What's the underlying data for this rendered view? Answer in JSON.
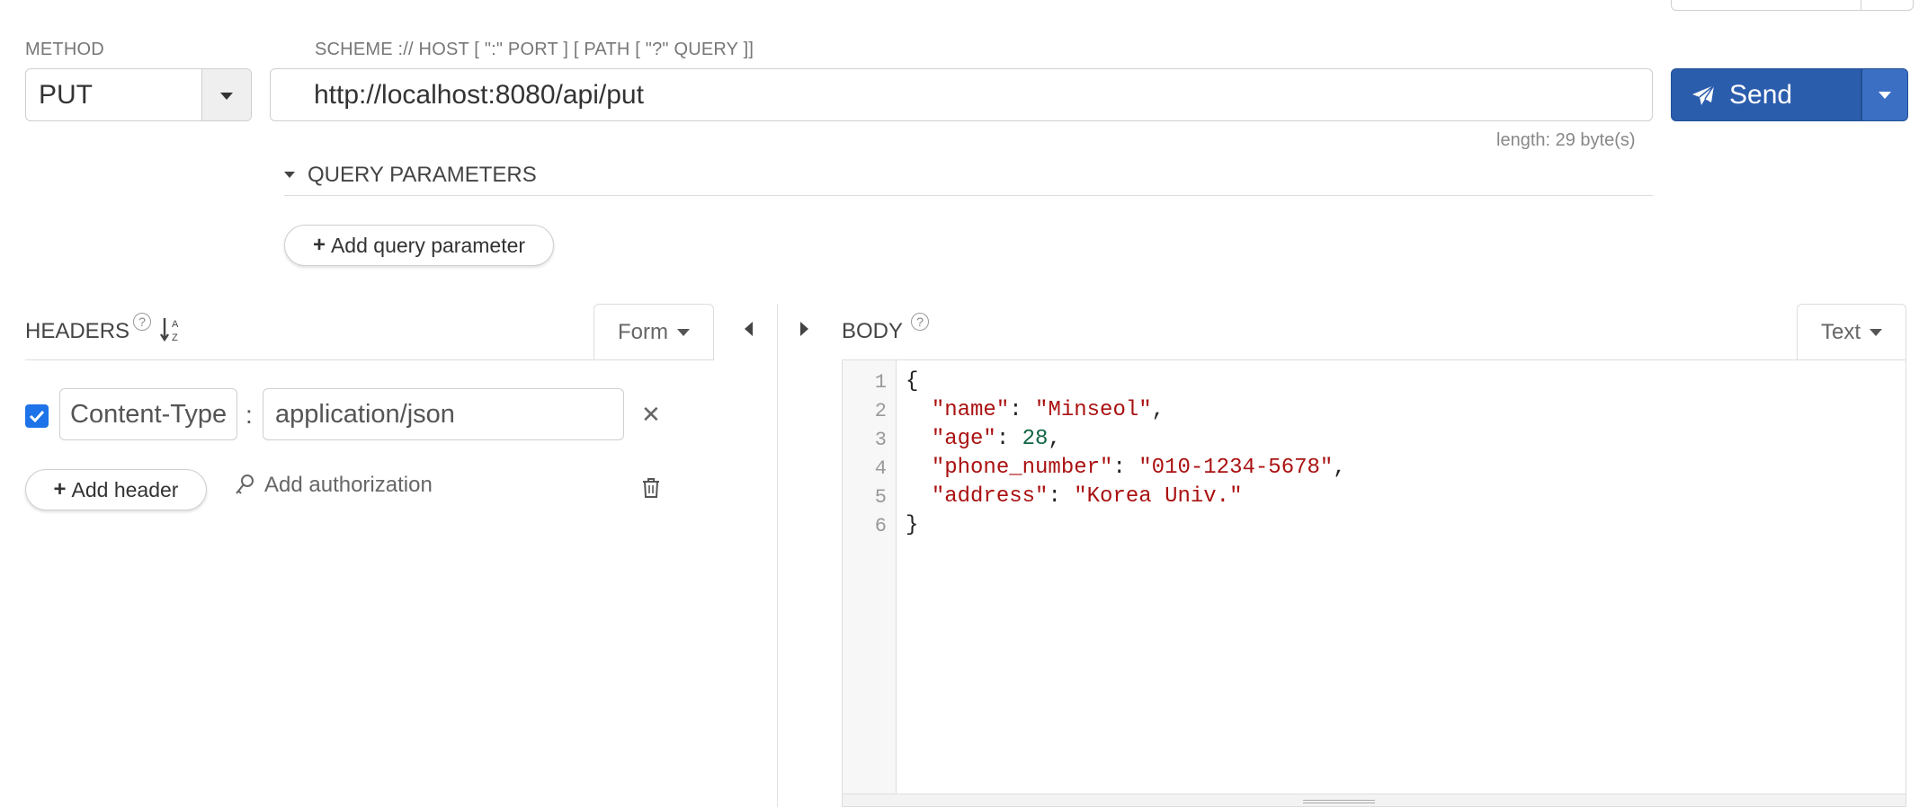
{
  "request": {
    "method_label": "METHOD",
    "method_value": "PUT",
    "url_label": "SCHEME :// HOST [ \":\" PORT ] [ PATH [ \"?\" QUERY ]]",
    "url_value": "http://localhost:8080/api/put",
    "length_text": "length: 29 byte(s)",
    "send_label": "Send"
  },
  "query": {
    "section_label": "QUERY PARAMETERS",
    "add_label": "Add query parameter"
  },
  "headers": {
    "title": "HEADERS",
    "mode": "Form",
    "rows": [
      {
        "enabled": true,
        "key": "Content-Type",
        "value": "application/json"
      }
    ],
    "add_label": "Add header",
    "auth_label": "Add authorization"
  },
  "body": {
    "title": "BODY",
    "mode": "Text",
    "line_numbers": [
      "1",
      "2",
      "3",
      "4",
      "5",
      "6"
    ],
    "json": {
      "name": "Minseol",
      "age": 28,
      "phone_number": "010-1234-5678",
      "address": "Korea Univ."
    }
  },
  "colors": {
    "send_bg": "#2b5dad",
    "checkbox": "#1e73e8",
    "code_string": "#aa1111",
    "code_number": "#116644"
  },
  "icons": {
    "method_caret": "chevron-down-icon",
    "send": "paper-plane-icon",
    "sort": "sort-alpha-icon",
    "help": "question-circle-icon",
    "auth": "key-icon",
    "delete": "trash-icon",
    "remove": "close-icon"
  }
}
